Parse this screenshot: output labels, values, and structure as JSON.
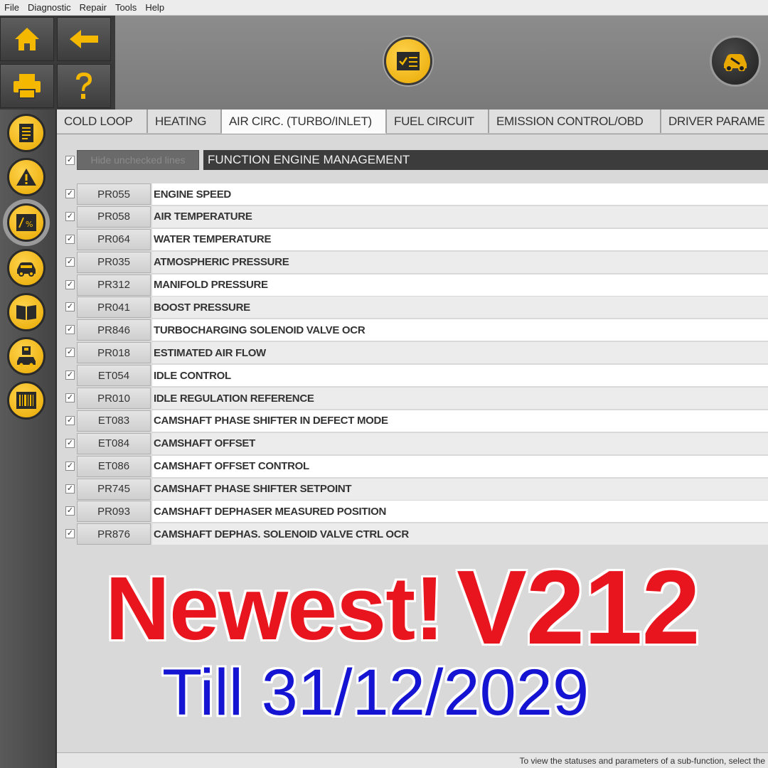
{
  "menu": [
    "File",
    "Diagnostic",
    "Repair",
    "Tools",
    "Help"
  ],
  "icons": {
    "home": "home-icon",
    "back": "arrow-left-icon",
    "print": "printer-icon",
    "help": "question-icon",
    "checklist": "checklist-icon",
    "vehicle": "car-wrench-icon"
  },
  "sidebar": [
    {
      "icon": "document-icon",
      "active": false
    },
    {
      "icon": "warning-icon",
      "active": false
    },
    {
      "icon": "parameter-percent-icon",
      "active": true
    },
    {
      "icon": "car-settings-icon",
      "active": false
    },
    {
      "icon": "manual-book-icon",
      "active": false
    },
    {
      "icon": "car-disk-icon",
      "active": false
    },
    {
      "icon": "barcode-icon",
      "active": false
    }
  ],
  "tabs": [
    {
      "label": "COLD LOOP",
      "active": false
    },
    {
      "label": "HEATING",
      "active": false
    },
    {
      "label": "AIR CIRC. (TURBO/INLET)",
      "active": true
    },
    {
      "label": "FUEL CIRCUIT",
      "active": false
    },
    {
      "label": "EMISSION CONTROL/OBD",
      "active": false
    },
    {
      "label": "DRIVER PARAME",
      "active": false
    }
  ],
  "filter": {
    "hide_label": "Hide unchecked lines",
    "function_title": "FUNCTION ENGINE MANAGEMENT"
  },
  "rows": [
    {
      "code": "PR055",
      "label": "ENGINE SPEED"
    },
    {
      "code": "PR058",
      "label": "AIR TEMPERATURE"
    },
    {
      "code": "PR064",
      "label": "WATER TEMPERATURE"
    },
    {
      "code": "PR035",
      "label": "ATMOSPHERIC PRESSURE"
    },
    {
      "code": "PR312",
      "label": "MANIFOLD PRESSURE"
    },
    {
      "code": "PR041",
      "label": "BOOST PRESSURE"
    },
    {
      "code": "PR846",
      "label": "TURBOCHARGING SOLENOID VALVE OCR"
    },
    {
      "code": "PR018",
      "label": "ESTIMATED AIR FLOW"
    },
    {
      "code": "ET054",
      "label": "IDLE CONTROL"
    },
    {
      "code": "PR010",
      "label": "IDLE REGULATION REFERENCE"
    },
    {
      "code": "ET083",
      "label": "CAMSHAFT PHASE SHIFTER IN DEFECT MODE"
    },
    {
      "code": "ET084",
      "label": "CAMSHAFT OFFSET"
    },
    {
      "code": "ET086",
      "label": "CAMSHAFT OFFSET CONTROL"
    },
    {
      "code": "PR745",
      "label": "CAMSHAFT PHASE SHIFTER SETPOINT"
    },
    {
      "code": "PR093",
      "label": "CAMSHAFT DEPHASER MEASURED POSITION"
    },
    {
      "code": "PR876",
      "label": "CAMSHAFT DEPHAS. SOLENOID VALVE CTRL OCR"
    }
  ],
  "promo": {
    "line1": "Newest!",
    "version": "V212",
    "line2": "Till 31/12/2029"
  },
  "status": "To view the statuses and parameters of a sub-function, select the",
  "colors": {
    "accent_yellow": "#f5b800",
    "promo_red": "#e8141e",
    "promo_blue": "#1414d2"
  }
}
